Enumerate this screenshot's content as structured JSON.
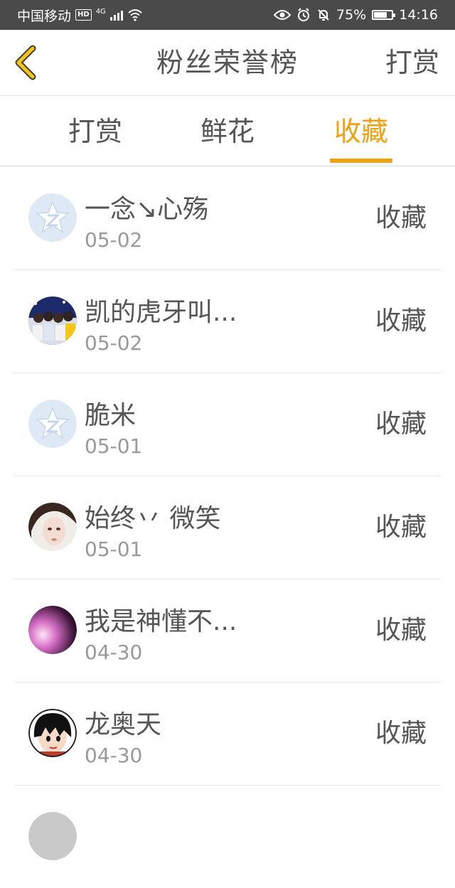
{
  "status_bar": {
    "carrier": "中国移动",
    "hd": "HD",
    "network": "4G",
    "battery": "75%",
    "time": "14:16"
  },
  "header": {
    "title": "粉丝荣誉榜",
    "action": "打赏"
  },
  "tabs": [
    {
      "label": "打赏",
      "active": false
    },
    {
      "label": "鲜花",
      "active": false
    },
    {
      "label": "收藏",
      "active": true
    }
  ],
  "rows": [
    {
      "name": "一念↘心殇",
      "date": "05-02",
      "action": "收藏",
      "avatar": "default-avatar-icon"
    },
    {
      "name": "凯的虎牙叫...",
      "date": "05-02",
      "action": "收藏",
      "avatar": "user-photo"
    },
    {
      "name": "脆米",
      "date": "05-01",
      "action": "收藏",
      "avatar": "default-avatar-icon"
    },
    {
      "name": "始终丷 微笑",
      "date": "05-01",
      "action": "收藏",
      "avatar": "user-photo"
    },
    {
      "name": "我是神懂不...",
      "date": "04-30",
      "action": "收藏",
      "avatar": "user-photo"
    },
    {
      "name": "龙奥天",
      "date": "04-30",
      "action": "收藏",
      "avatar": "user-photo"
    },
    {
      "name": "",
      "date": "",
      "action": "",
      "avatar": "user-photo"
    }
  ],
  "colors": {
    "accent": "#f0a010",
    "status_bar": "#4a4a4a",
    "text": "#555555",
    "subtext": "#999999"
  }
}
